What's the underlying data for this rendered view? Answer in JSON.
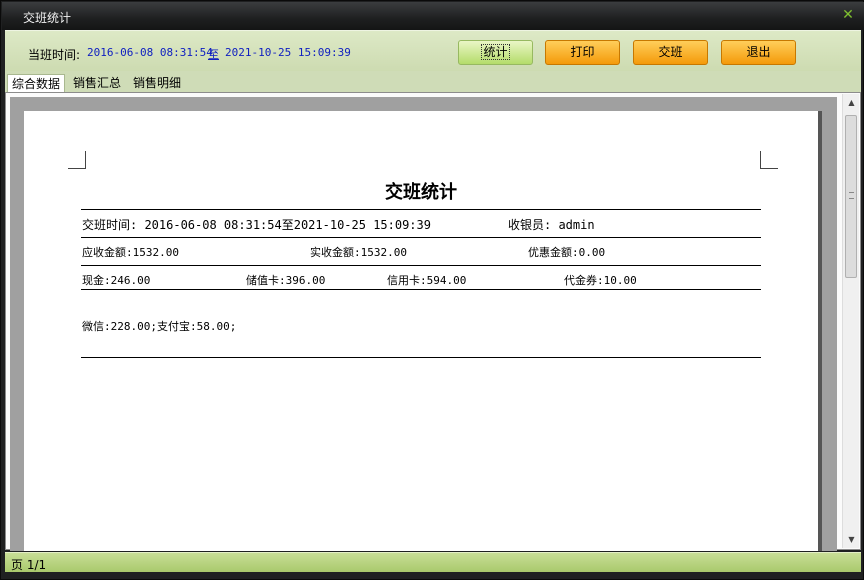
{
  "window": {
    "title": "交班统计"
  },
  "toolbar": {
    "time_label": "当班时间:",
    "start_time": "2016-06-08 08:31:54",
    "to": "至",
    "end_time": "2021-10-25 15:09:39",
    "buttons": {
      "stats": "统计",
      "print": "打印",
      "shift": "交班",
      "exit": "退出"
    }
  },
  "tabs": [
    "综合数据",
    "销售汇总",
    "销售明细"
  ],
  "report": {
    "title": "交班统计",
    "shift_time": "交班时间: 2016-06-08 08:31:54至2021-10-25 15:09:39",
    "cashier": "收银员: admin",
    "receivable": "应收金额:1532.00",
    "received": "实收金额:1532.00",
    "discount": "优惠金额:0.00",
    "cash": "现金:246.00",
    "stored_card": "储值卡:396.00",
    "credit_card": "信用卡:594.00",
    "voucher": "代金券:10.00",
    "other_payments": "微信:228.00;支付宝:58.00;"
  },
  "status": {
    "page": "页 1/1"
  }
}
